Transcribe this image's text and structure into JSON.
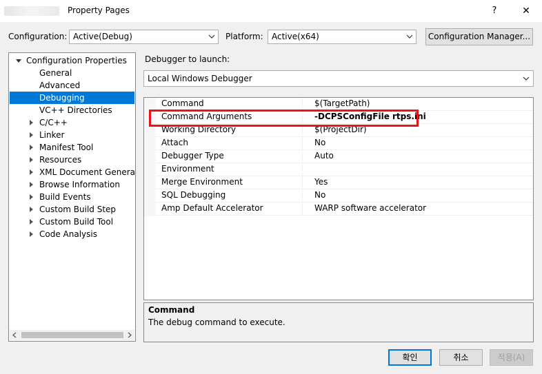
{
  "window": {
    "title": "Property Pages",
    "help": "?",
    "close": "✕"
  },
  "config": {
    "configuration_label": "Configuration:",
    "configuration_value": "Active(Debug)",
    "platform_label": "Platform:",
    "platform_value": "Active(x64)",
    "manager_button": "Configuration Manager..."
  },
  "tree": {
    "root": "Configuration Properties",
    "items": [
      {
        "label": "General",
        "expandable": false
      },
      {
        "label": "Advanced",
        "expandable": false
      },
      {
        "label": "Debugging",
        "expandable": false,
        "selected": true
      },
      {
        "label": "VC++ Directories",
        "expandable": false
      },
      {
        "label": "C/C++",
        "expandable": true
      },
      {
        "label": "Linker",
        "expandable": true
      },
      {
        "label": "Manifest Tool",
        "expandable": true
      },
      {
        "label": "Resources",
        "expandable": true
      },
      {
        "label": "XML Document Generator",
        "expandable": true
      },
      {
        "label": "Browse Information",
        "expandable": true
      },
      {
        "label": "Build Events",
        "expandable": true
      },
      {
        "label": "Custom Build Step",
        "expandable": true
      },
      {
        "label": "Custom Build Tool",
        "expandable": true
      },
      {
        "label": "Code Analysis",
        "expandable": true
      }
    ]
  },
  "debugger": {
    "label": "Debugger to launch:",
    "value": "Local Windows Debugger"
  },
  "properties": [
    {
      "name": "Command",
      "value": "$(TargetPath)"
    },
    {
      "name": "Command Arguments",
      "value": "-DCPSConfigFile rtps.ini",
      "bold": true
    },
    {
      "name": "Working Directory",
      "value": "$(ProjectDir)"
    },
    {
      "name": "Attach",
      "value": "No"
    },
    {
      "name": "Debugger Type",
      "value": "Auto"
    },
    {
      "name": "Environment",
      "value": ""
    },
    {
      "name": "Merge Environment",
      "value": "Yes"
    },
    {
      "name": "SQL Debugging",
      "value": "No"
    },
    {
      "name": "Amp Default Accelerator",
      "value": "WARP software accelerator"
    }
  ],
  "description": {
    "title": "Command",
    "text": "The debug command to execute."
  },
  "buttons": {
    "ok": "확인",
    "cancel": "취소",
    "apply": "적용(A)"
  },
  "colors": {
    "selection": "#0078d7",
    "highlight_box": "#e8141c"
  }
}
